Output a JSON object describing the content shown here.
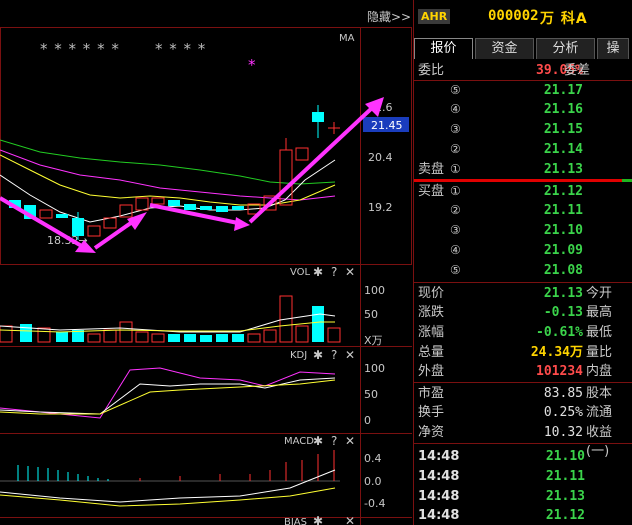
{
  "chart": {
    "hide_label": "隐藏>>",
    "ma_label": "MA",
    "stars_left": "* * * * * *",
    "stars_right": "* * * *",
    "magenta_star": "*",
    "price_labels": [
      "21.6",
      "20.4",
      "19.2"
    ],
    "current_price_tag": "21.45",
    "low_marker": "18.32→",
    "vol_title": "VOL",
    "vol_axis": [
      "100",
      "50",
      "X万"
    ],
    "kdj_title": "KDJ",
    "kdj_axis": [
      "100",
      "50",
      "0"
    ],
    "macd_title": "MACD",
    "macd_axis": [
      "0.4",
      "0.0",
      "-0.4"
    ],
    "bias_title": "BIAS",
    "panel_icons": [
      "gear-icon",
      "help-icon",
      "close-icon"
    ],
    "colors": {
      "up": "#ff3030",
      "down": "#00ffff",
      "arrow": "#ff33ff",
      "ma1": "#ffffff",
      "ma2": "#ffff33",
      "ma3": "#ff33ff",
      "ma4": "#22cc22"
    }
  },
  "quote": {
    "badge": "AHR",
    "code": "000002",
    "name": "万  科A",
    "tabs": [
      "报价",
      "资金",
      "分析",
      "操"
    ],
    "ratio_label": "委比",
    "ratio_value": "39.05%",
    "diff_label": "委差",
    "sell": [
      {
        "label": "",
        "level": "⑤",
        "price": "21.17"
      },
      {
        "label": "",
        "level": "④",
        "price": "21.16"
      },
      {
        "label": "",
        "level": "③",
        "price": "21.15"
      },
      {
        "label": "",
        "level": "②",
        "price": "21.14"
      },
      {
        "label": "卖盘",
        "level": "①",
        "price": "21.13"
      }
    ],
    "buy": [
      {
        "label": "买盘",
        "level": "①",
        "price": "21.12"
      },
      {
        "label": "",
        "level": "②",
        "price": "21.11"
      },
      {
        "label": "",
        "level": "③",
        "price": "21.10"
      },
      {
        "label": "",
        "level": "④",
        "price": "21.09"
      },
      {
        "label": "",
        "level": "⑤",
        "price": "21.08"
      }
    ],
    "stats": [
      {
        "l1": "现价",
        "v1": "21.13",
        "c1": "green",
        "l2": "今开"
      },
      {
        "l1": "涨跌",
        "v1": "-0.13",
        "c1": "green",
        "l2": "最高"
      },
      {
        "l1": "涨幅",
        "v1": "-0.61%",
        "c1": "green",
        "l2": "最低"
      },
      {
        "l1": "总量",
        "v1": "24.34万",
        "c1": "yellow",
        "l2": "量比"
      },
      {
        "l1": "外盘",
        "v1": "101234",
        "c1": "red",
        "l2": "内盘"
      }
    ],
    "fund": [
      {
        "l1": "市盈",
        "v1": "83.85",
        "l2": "股本"
      },
      {
        "l1": "换手",
        "v1": "0.25%",
        "l2": "流通"
      },
      {
        "l1": "净资",
        "v1": "10.32",
        "l2": "收益(一)"
      }
    ],
    "ticks": [
      {
        "time": "14:48",
        "price": "21.10"
      },
      {
        "time": "14:48",
        "price": "21.11"
      },
      {
        "time": "14:48",
        "price": "21.13"
      },
      {
        "time": "14:48",
        "price": "21.12"
      }
    ]
  }
}
